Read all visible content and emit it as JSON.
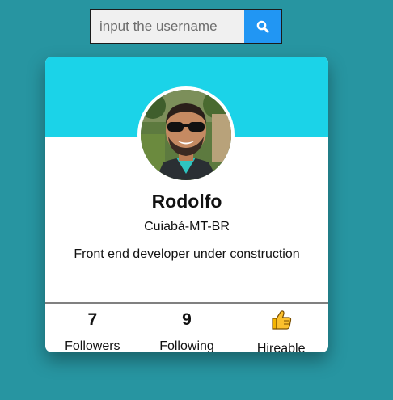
{
  "search": {
    "placeholder": "input the username",
    "button_icon": "search-icon"
  },
  "profile": {
    "name": "Rodolfo",
    "location": "Cuiabá-MT-BR",
    "bio": "Front end developer under construction",
    "avatar_icon": "avatar-photo"
  },
  "stats": {
    "followers": {
      "value": "7",
      "label": "Followers"
    },
    "following": {
      "value": "9",
      "label": "Following"
    },
    "hireable": {
      "icon": "thumbs-up-icon",
      "label": "Hireable"
    }
  },
  "colors": {
    "background": "#2795a1",
    "header": "#1bd3e8",
    "search_button": "#2196f3",
    "card": "#ffffff"
  }
}
